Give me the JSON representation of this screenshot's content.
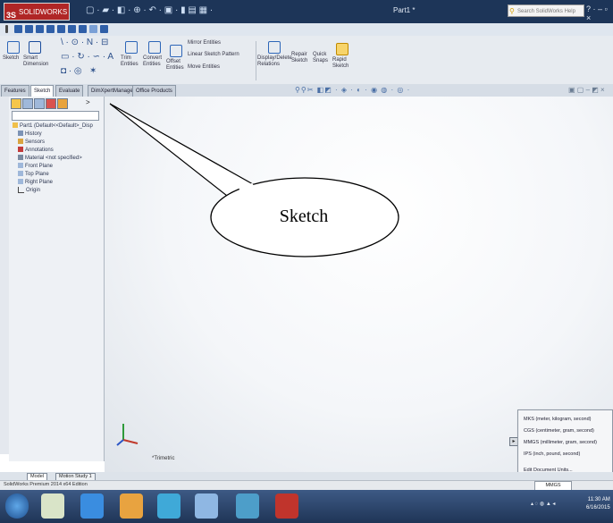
{
  "app": {
    "name": "SOLIDWORKS",
    "document_title": "Part1 *"
  },
  "search": {
    "placeholder": "Search SolidWorks Help"
  },
  "ribbon": {
    "sketch": "Sketch",
    "smart_dimension": "Smart Dimension",
    "trim": "Trim Entities",
    "convert": "Convert Entities",
    "offset": "Offset Entities",
    "mirror": "Mirror Entities",
    "linear_pattern": "Linear Sketch Pattern",
    "move": "Move Entities",
    "display_delete": "Display/Delete Relations",
    "repair": "Repair Sketch",
    "quick_snaps": "Quick Snaps",
    "rapid_sketch": "Rapid Sketch"
  },
  "tabs": [
    "Features",
    "Sketch",
    "Evaluate",
    "DimXpertManager",
    "Office Products"
  ],
  "active_tab": "Sketch",
  "feature_tree": [
    "Part1 (Default<<Default>_Disp",
    "History",
    "Sensors",
    "Annotations",
    "Material <not specified>",
    "Front Plane",
    "Top Plane",
    "Right Plane",
    "Origin"
  ],
  "callout": {
    "text": "Sketch"
  },
  "view_orientation": "*Trimetric",
  "units_menu": [
    "MKS (meter, kilogram, second)",
    "CGS (centimeter, gram, second)",
    "MMGS (millimeter, gram, second)",
    "IPS (inch, pound, second)",
    "Edit Document Units..."
  ],
  "bottom_tabs": [
    "Model",
    "Motion Study 1"
  ],
  "status": {
    "text": "SolidWorks Premium 2014 x64 Edition",
    "units": "MMGS"
  },
  "clock": {
    "time": "11:30 AM",
    "date": "6/16/2015"
  },
  "colors": {
    "titlebar": "#1d3558",
    "logo": "#b02626",
    "taskbar": "#2a4468"
  }
}
